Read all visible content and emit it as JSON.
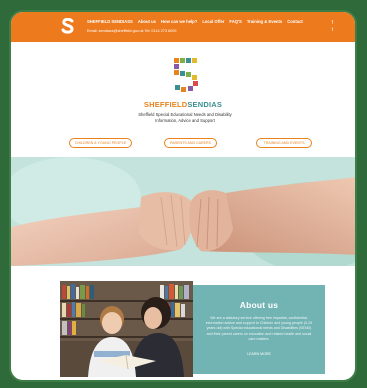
{
  "header": {
    "brand": "SHEFFIELD SENDIASS",
    "nav": [
      "About us",
      "How can we help?",
      "Local Offer",
      "FAQ'S",
      "Training & Events",
      "Contact"
    ],
    "contact_line": "Email: sendiass@sheffield.gov.uk    Tel: 0114 273 6009",
    "social": [
      "f",
      "t"
    ],
    "colors": {
      "bar": "#ee7a1e"
    }
  },
  "hero": {
    "title_part1": "SHEFFIELD",
    "title_part2": "SENDIAS",
    "tagline": "Sheffield Special Educational Needs and Disability Information, Advice and Support",
    "buttons": [
      "CHILDREN & YOUNG PEOPLE",
      "PARENTS AND CARERS",
      "TRAINING AND EVENTS"
    ]
  },
  "about": {
    "heading": "About us",
    "body": "We are a statutory service offering free impartial, confidential, information advice and support to Children and young people (0-25 years old) with Special educational needs and Disabilities (SEND) and their parent carers on education and related health and social care matters.",
    "link": "LEARN MORE",
    "colors": {
      "card": "#72b3b3"
    }
  }
}
